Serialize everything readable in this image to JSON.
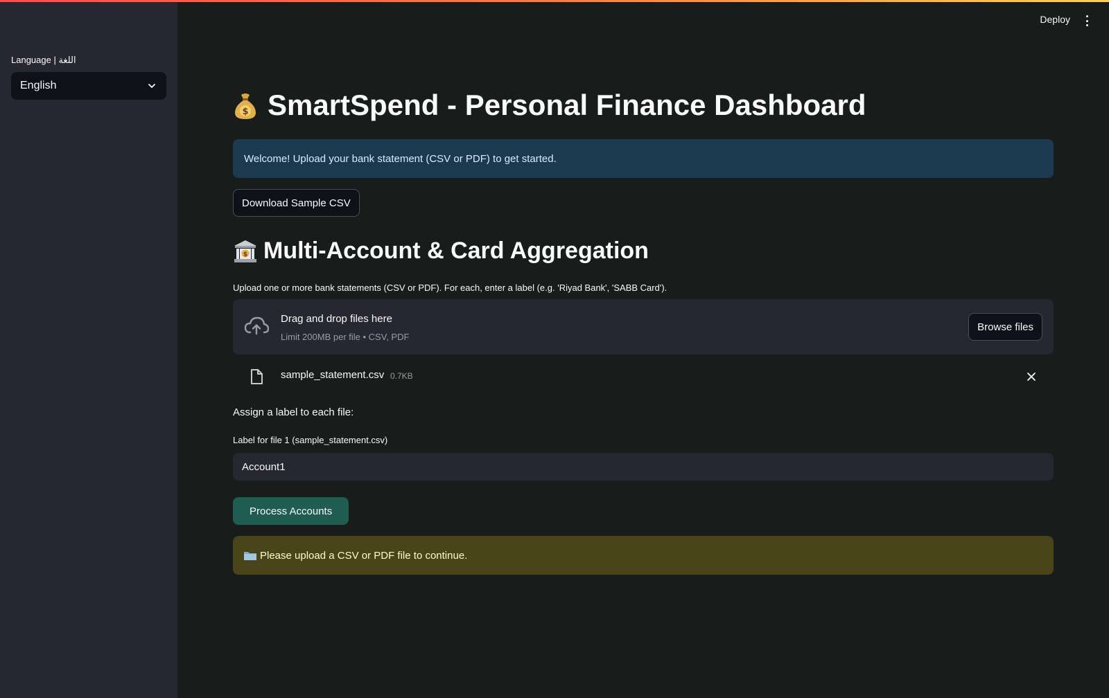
{
  "header": {
    "deploy_label": "Deploy",
    "menu_icon": "kebab-menu-icon"
  },
  "sidebar": {
    "language_label": "Language | اللغة",
    "language_value": "English"
  },
  "main": {
    "title": "SmartSpend - Personal Finance Dashboard",
    "title_icon": "money-bag-emoji",
    "welcome_text": "Welcome! Upload your bank statement (CSV or PDF) to get started.",
    "download_button": "Download Sample CSV",
    "section_title": "Multi-Account & Card Aggregation",
    "section_icon": "bank-emoji",
    "instructions": "Upload one or more bank statements (CSV or PDF). For each, enter a label (e.g. 'Riyad Bank', 'SABB Card').",
    "uploader": {
      "title": "Drag and drop files here",
      "limit": "Limit 200MB per file • CSV, PDF",
      "browse_button": "Browse files"
    },
    "uploaded_file": {
      "name": "sample_statement.csv",
      "size": "0.7KB"
    },
    "assign_text": "Assign a label to each file:",
    "field_label": "Label for file 1 (sample_statement.csv)",
    "field_value": "Account1",
    "process_button": "Process Accounts",
    "warning_text": "Please upload a CSV or PDF file to continue."
  },
  "colors": {
    "background": "#181c1b",
    "sidebar": "#262730",
    "info": "#1c3a4f",
    "warning": "#49441a",
    "primary_button": "#1f5c52"
  }
}
